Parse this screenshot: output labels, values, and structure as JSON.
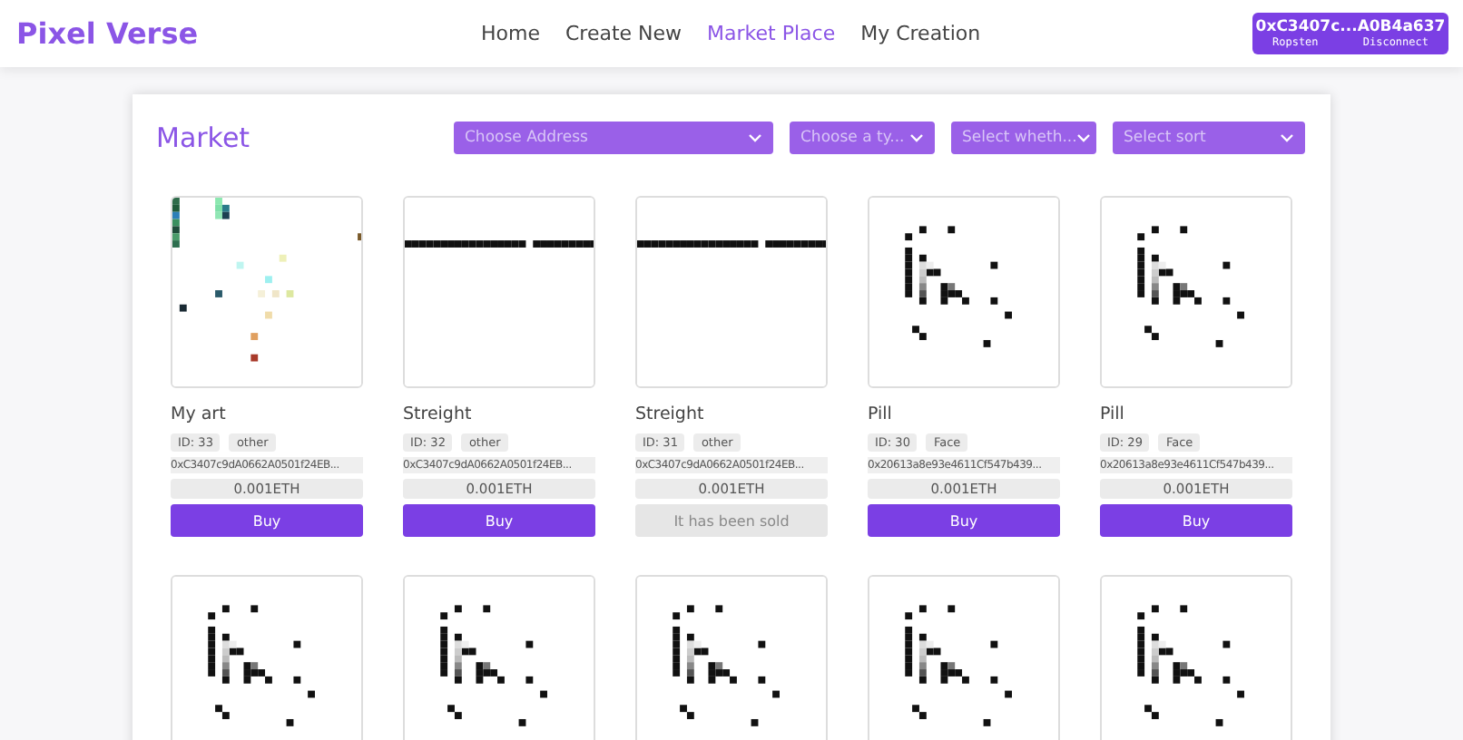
{
  "navbar": {
    "logo": "Pixel Verse",
    "links": [
      {
        "label": "Home",
        "selected": false
      },
      {
        "label": "Create New",
        "selected": false
      },
      {
        "label": "Market Place",
        "selected": true
      },
      {
        "label": "My Creation",
        "selected": false
      }
    ],
    "wallet": {
      "address": "0xC3407c...A0B4a637",
      "network": "Ropsten",
      "action": "Disconnect"
    }
  },
  "market": {
    "title": "Market",
    "filters": [
      {
        "placeholder": "Choose Address"
      },
      {
        "placeholder": "Choose a ty..."
      },
      {
        "placeholder": "Select wheth..."
      },
      {
        "placeholder": "Select sort"
      }
    ],
    "items": [
      {
        "kind": "colorful",
        "name": "My art",
        "id": "ID: 33",
        "type": "other",
        "owner": "0xC3407c9dA0662A0501f24EB...",
        "price": "0.001ETH",
        "button": "Buy",
        "sold": false
      },
      {
        "kind": "line",
        "name": "Streight",
        "id": "ID: 32",
        "type": "other",
        "owner": "0xC3407c9dA0662A0501f24EB...",
        "price": "0.001ETH",
        "button": "Buy",
        "sold": false
      },
      {
        "kind": "line",
        "name": "Streight",
        "id": "ID: 31",
        "type": "other",
        "owner": "0xC3407c9dA0662A0501f24EB...",
        "price": "0.001ETH",
        "button": "It has been sold",
        "sold": true
      },
      {
        "kind": "pill",
        "name": "Pill",
        "id": "ID: 30",
        "type": "Face",
        "owner": "0x20613a8e93e4611Cf547b439...",
        "price": "0.001ETH",
        "button": "Buy",
        "sold": false
      },
      {
        "kind": "pill",
        "name": "Pill",
        "id": "ID: 29",
        "type": "Face",
        "owner": "0x20613a8e93e4611Cf547b439...",
        "price": "0.001ETH",
        "button": "Buy",
        "sold": false
      },
      {
        "kind": "pill"
      },
      {
        "kind": "pill"
      },
      {
        "kind": "pill"
      },
      {
        "kind": "pill"
      },
      {
        "kind": "pill"
      }
    ]
  }
}
